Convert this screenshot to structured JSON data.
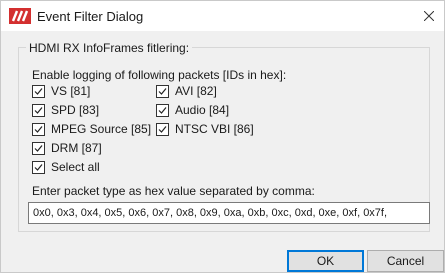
{
  "window": {
    "title": "Event Filter Dialog",
    "icon": "app-logo-icon",
    "close_icon": "close-icon",
    "accent": "#d32f2f"
  },
  "group": {
    "title": "HDMI RX InfoFrames fitlering:",
    "enable_label": "Enable logging of following packets [IDs in hex]:"
  },
  "packets": [
    {
      "label": "VS [81]",
      "checked": true
    },
    {
      "label": "AVI [82]",
      "checked": true
    },
    {
      "label": "SPD [83]",
      "checked": true
    },
    {
      "label": "Audio [84]",
      "checked": true
    },
    {
      "label": "MPEG Source [85]",
      "checked": true
    },
    {
      "label": "NTSC VBI [86]",
      "checked": true
    },
    {
      "label": "DRM [87]",
      "checked": true
    },
    {
      "label": "Select all",
      "checked": true
    }
  ],
  "hex": {
    "label": "Enter packet type as hex value separated by comma:",
    "value": "0x0, 0x3, 0x4, 0x5, 0x6, 0x7, 0x8, 0x9, 0xa, 0xb, 0xc, 0xd, 0xe, 0xf, 0x7f,"
  },
  "buttons": {
    "ok": "OK",
    "cancel": "Cancel"
  }
}
